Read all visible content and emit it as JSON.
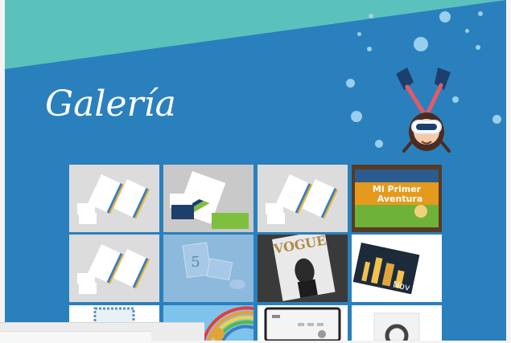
{
  "page": {
    "title": "Galería"
  },
  "colors": {
    "background": "#2a80bd",
    "band": "#5bc1bc",
    "bubble": "#9fd3f0"
  },
  "diver": {
    "icon": "diver-illustration-icon"
  },
  "gallery": {
    "items": [
      {
        "name": "stationery-set-1",
        "icon": "stationery-thumbnail-icon"
      },
      {
        "name": "corporate-identity-green",
        "icon": "stationery-thumbnail-icon"
      },
      {
        "name": "stationery-set-2",
        "icon": "stationery-thumbnail-icon"
      },
      {
        "name": "mi-primer-aventura-book",
        "icon": "book-cover-icon",
        "text_line1": "Mi Primer",
        "text_line2": "Aventura"
      },
      {
        "name": "stationery-set-3",
        "icon": "stationery-thumbnail-icon"
      },
      {
        "name": "invitation-cards",
        "icon": "invitation-thumbnail-icon",
        "text": "5"
      },
      {
        "name": "vogue-magazine",
        "icon": "magazine-cover-icon",
        "text": "VOGUE"
      },
      {
        "name": "night-city-flyers",
        "icon": "flyer-thumbnail-icon",
        "text": "Nov"
      },
      {
        "name": "frame-thumbnail",
        "icon": "frame-thumbnail-icon"
      },
      {
        "name": "rainbow-illustration",
        "icon": "illustration-thumbnail-icon"
      },
      {
        "name": "web-mockup",
        "icon": "web-mockup-icon"
      },
      {
        "name": "circle-product",
        "icon": "product-thumbnail-icon"
      }
    ]
  }
}
